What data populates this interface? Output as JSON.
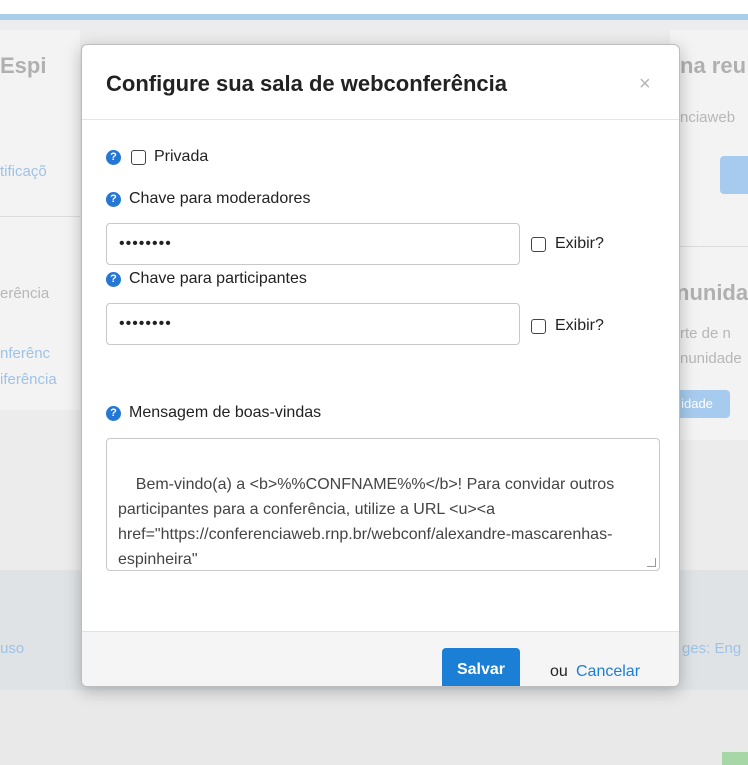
{
  "background": {
    "heading_left": "Espi",
    "heading_right": "na reu",
    "link_left_1": "tificaçõ",
    "muted_right_1": "nciaweb",
    "muted_left_2": "erência",
    "heading_right_2": "nunida",
    "muted_right_2": "rte de n",
    "muted_right_3": "nunidade",
    "link_left_3": "nferênc",
    "link_left_4": "iferência",
    "badge_label": "idade",
    "footer_left": "uso",
    "footer_right": "ges: Eng"
  },
  "modal": {
    "title": "Configure sua sala de webconferência",
    "close_symbol": "×",
    "help_symbol": "?",
    "private_label": "Privada",
    "moderator_key_label": "Chave para moderadores",
    "moderator_key_value": "••••••••",
    "participant_key_label": "Chave para participantes",
    "participant_key_value": "••••••••",
    "show_label": "Exibir?",
    "welcome_label": "Mensagem de boas-vindas",
    "welcome_text": "Bem-vindo(a) a <b>%%CONFNAME%%</b>! Para convidar outros participantes para a conferência, utilize a URL <u><a href=\"https://conferenciaweb.rnp.br/webconf/alexandre-mascarenhas-espinheira\"",
    "save_label": "Salvar",
    "or_label": "ou",
    "cancel_label": "Cancelar"
  },
  "colors": {
    "primary": "#1b7fd6",
    "help_icon": "#2577d6"
  }
}
